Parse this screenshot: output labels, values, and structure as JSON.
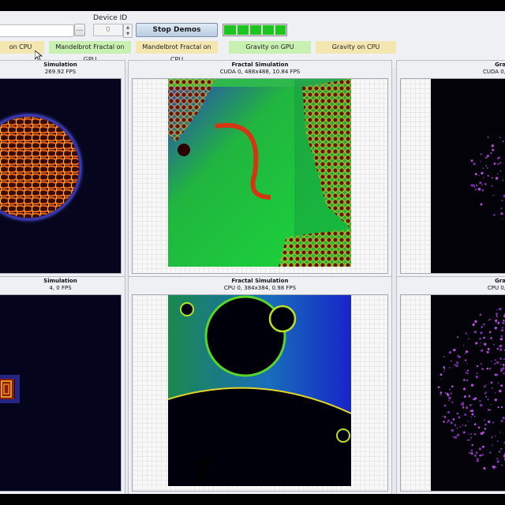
{
  "toolbar": {
    "path_value": "",
    "browse_label": "...",
    "device_label": "Device ID",
    "device_value": "0",
    "stop_label": "Stop Demos",
    "progress_fraction": 1.0,
    "modes": [
      {
        "label": "on CPU",
        "color": "#f3e6b0"
      },
      {
        "label": "Mandelbrot Fractal on GPU",
        "color": "#c8f0b0"
      },
      {
        "label": "Mandelbrot Fractal on CPU",
        "color": "#f3e6b0"
      },
      {
        "label": "Gravity on GPU",
        "color": "#c8f0b0"
      },
      {
        "label": "Gravity on CPU",
        "color": "#f3e6b0"
      }
    ]
  },
  "panels": [
    {
      "title": "Simulation",
      "stats": "269.92 FPS",
      "kind": "turing"
    },
    {
      "title": "Fractal Simulation",
      "stats": "CUDA 0, 488x488, 10.84 FPS",
      "kind": "fractal-gpu"
    },
    {
      "title": "Gra",
      "stats": "CUDA 0,",
      "kind": "gravity-sparse"
    },
    {
      "title": "Simulation",
      "stats": "4, 0 FPS",
      "kind": "turing-small"
    },
    {
      "title": "Fractal Simulation",
      "stats": "CPU 0, 384x384, 0.98 FPS",
      "kind": "fractal-cpu"
    },
    {
      "title": "Gra",
      "stats": "CPU 0,",
      "kind": "gravity-dense"
    }
  ],
  "colors": {
    "accent_blue": "#c2d4ea",
    "progress_green": "#1ec51e"
  }
}
